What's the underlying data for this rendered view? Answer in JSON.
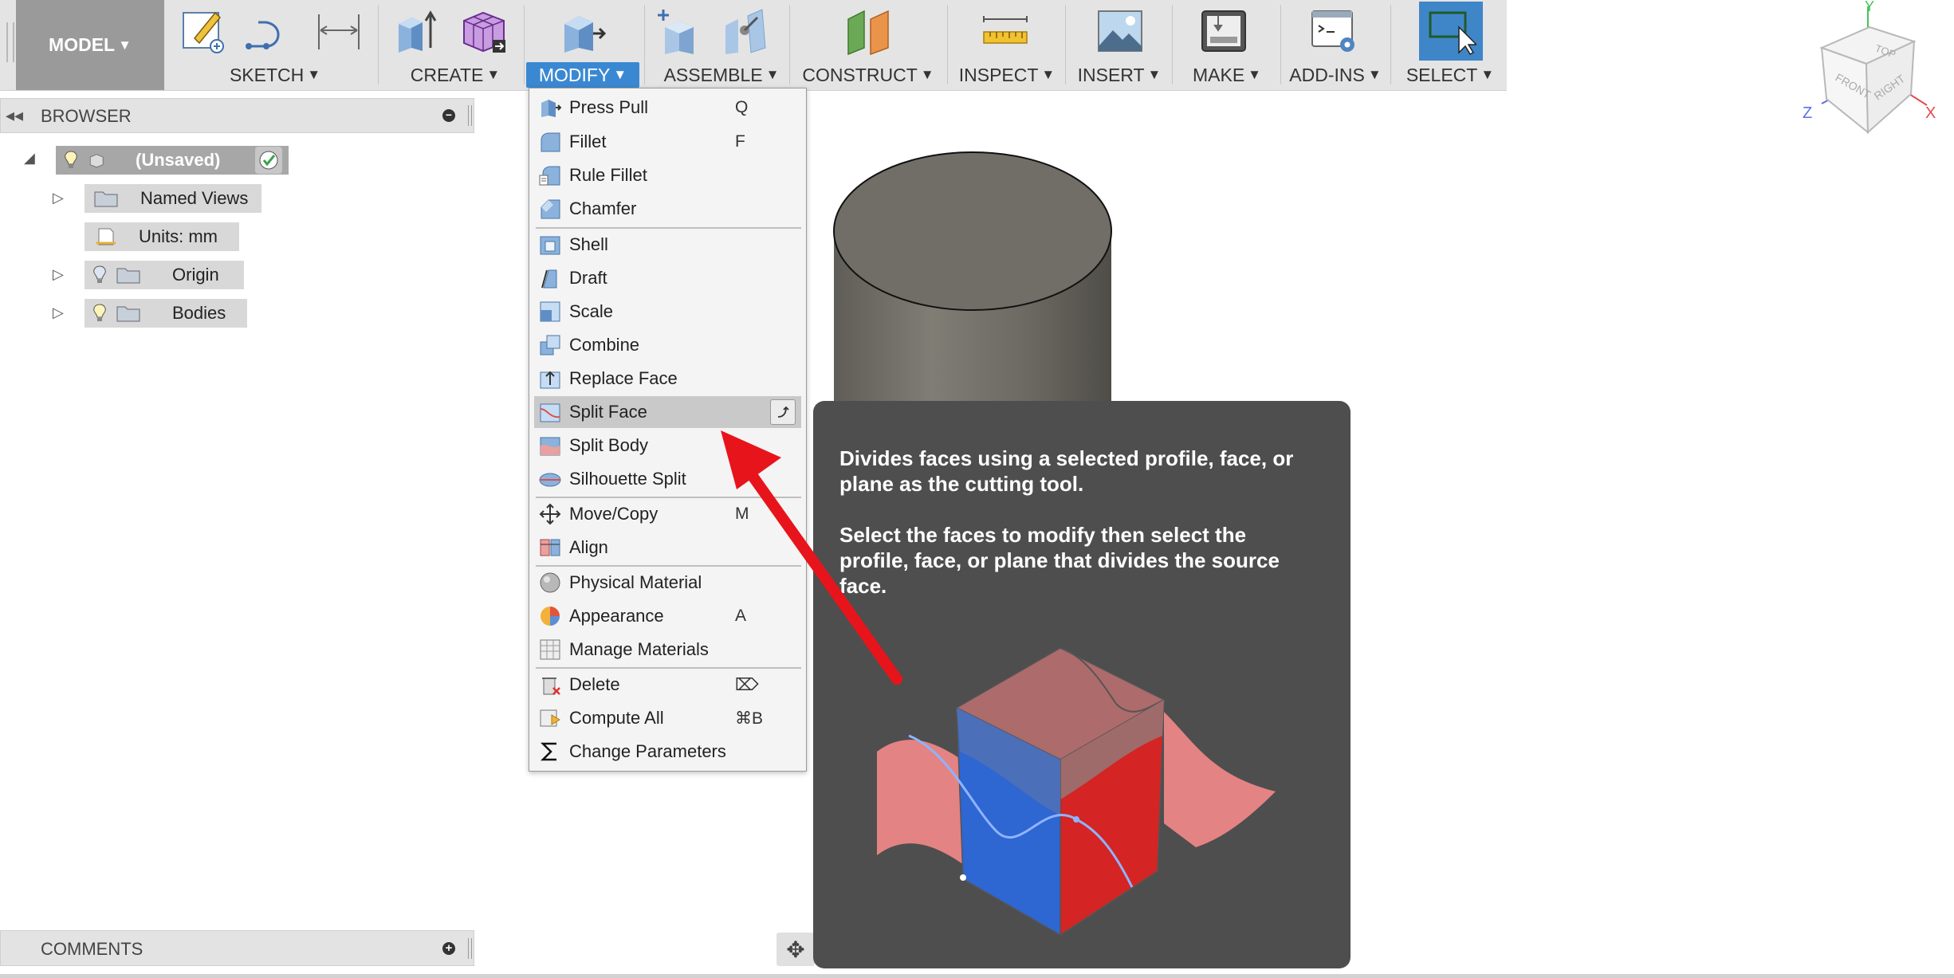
{
  "toolbar": {
    "workspace": "MODEL",
    "groups": [
      {
        "label": "SKETCH"
      },
      {
        "label": "CREATE"
      },
      {
        "label": "MODIFY"
      },
      {
        "label": "ASSEMBLE"
      },
      {
        "label": "CONSTRUCT"
      },
      {
        "label": "INSPECT"
      },
      {
        "label": "INSERT"
      },
      {
        "label": "MAKE"
      },
      {
        "label": "ADD-INS"
      },
      {
        "label": "SELECT"
      }
    ],
    "caret": "▼"
  },
  "browser": {
    "title": "BROWSER",
    "root": "(Unsaved)",
    "nodes": [
      {
        "label": "Named Views"
      },
      {
        "label": "Units: mm"
      },
      {
        "label": "Origin"
      },
      {
        "label": "Bodies"
      }
    ]
  },
  "comments": {
    "title": "COMMENTS"
  },
  "modify_menu": {
    "items": [
      {
        "label": "Press Pull",
        "shortcut": "Q"
      },
      {
        "label": "Fillet",
        "shortcut": "F"
      },
      {
        "label": "Rule Fillet",
        "shortcut": ""
      },
      {
        "label": "Chamfer",
        "shortcut": ""
      },
      {
        "label": "Shell",
        "shortcut": ""
      },
      {
        "label": "Draft",
        "shortcut": ""
      },
      {
        "label": "Scale",
        "shortcut": ""
      },
      {
        "label": "Combine",
        "shortcut": ""
      },
      {
        "label": "Replace Face",
        "shortcut": ""
      },
      {
        "label": "Split Face",
        "shortcut": ""
      },
      {
        "label": "Split Body",
        "shortcut": ""
      },
      {
        "label": "Silhouette Split",
        "shortcut": ""
      },
      {
        "label": "Move/Copy",
        "shortcut": "M"
      },
      {
        "label": "Align",
        "shortcut": ""
      },
      {
        "label": "Physical Material",
        "shortcut": ""
      },
      {
        "label": "Appearance",
        "shortcut": "A"
      },
      {
        "label": "Manage Materials",
        "shortcut": ""
      },
      {
        "label": "Delete",
        "shortcut": "⌦"
      },
      {
        "label": "Compute All",
        "shortcut": "⌘B"
      },
      {
        "label": "Change Parameters",
        "shortcut": ""
      }
    ],
    "highlighted": "Split Face"
  },
  "tooltip": {
    "paragraph1": "Divides faces using a selected profile, face, or plane as the cutting tool.",
    "paragraph2": "Select the faces to modify then select the profile, face, or plane that divides the source face."
  },
  "viewcube": {
    "faces": {
      "top": "TOP",
      "front": "FRONT",
      "right": "RIGHT"
    },
    "axes": {
      "x": "X",
      "y": "Y",
      "z": "Z"
    }
  },
  "colors": {
    "toolbar_bg": "#e4e4e4",
    "model_btn": "#9a9a9a",
    "accent_blue": "#3b88d2",
    "tooltip_bg": "#4e4e4e",
    "arrow_red": "#e8141b",
    "menu_highlight": "#c9c9c9"
  }
}
